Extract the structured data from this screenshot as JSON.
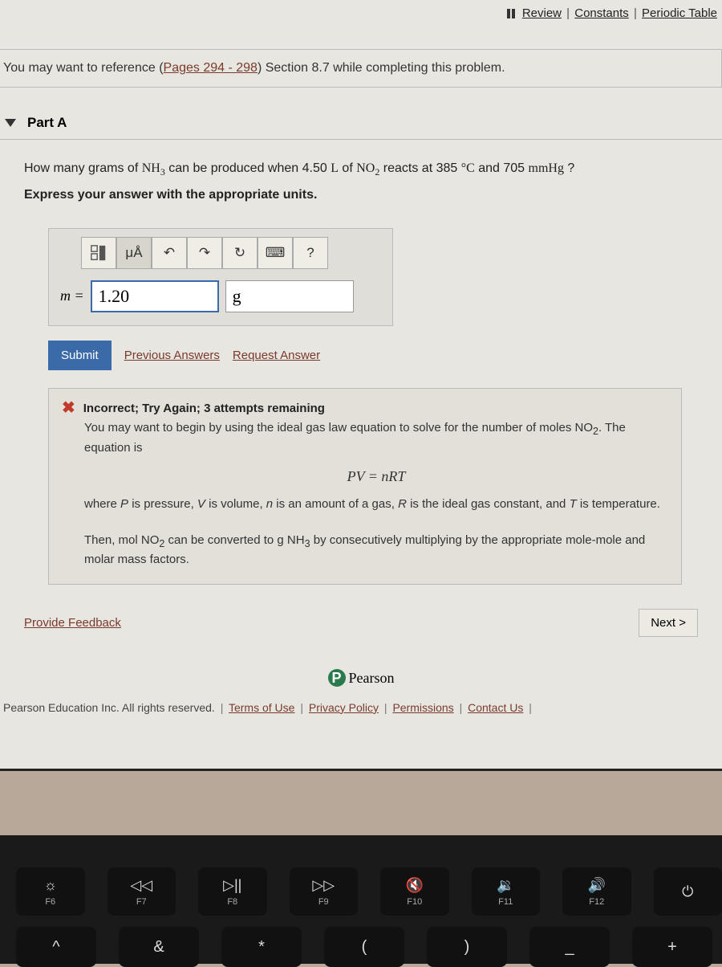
{
  "top_links": {
    "review": "Review",
    "constants": "Constants",
    "periodic": "Periodic Table"
  },
  "reference": {
    "prefix": "You may want to reference (",
    "pages": "Pages 294 - 298",
    "suffix": ") Section 8.7 while completing this problem."
  },
  "part": {
    "label": "Part A"
  },
  "question": {
    "pre": "How many grams of ",
    "chem1a": "NH",
    "chem1b": "3",
    "mid1": " can be produced when 4.50 ",
    "L": "L",
    "mid2": " of ",
    "chem2a": "NO",
    "chem2b": "2",
    "mid3": " reacts at 385 ",
    "deg": "°C",
    "mid4": " and 705 ",
    "mmhg": "mmHg",
    "qmark": " ?",
    "instruction": "Express your answer with the appropriate units."
  },
  "toolbar": {
    "templates": "templates",
    "units_label": "μÅ",
    "undo": "↶",
    "redo": "↷",
    "reset": "↻",
    "keyboard": "⌨",
    "help": "?"
  },
  "answer": {
    "var": "m =",
    "value": "1.20",
    "unit": "g"
  },
  "actions": {
    "submit": "Submit",
    "previous": "Previous Answers",
    "request": "Request Answer"
  },
  "feedback": {
    "title": "Incorrect; Try Again; 3 attempts remaining",
    "line1a": "You may want to begin by using the ideal gas law equation to solve for the number of moles ",
    "line1chem_a": "NO",
    "line1chem_b": "2",
    "line1b": ". The equation is",
    "equation": "PV = nRT",
    "line2a": "where ",
    "P": "P",
    "line2b": " is pressure, ",
    "V": "V",
    "line2c": " is volume, ",
    "n": "n",
    "line2d": " is an amount of a gas, ",
    "R": "R",
    "line2e": " is the ideal gas constant, and ",
    "T": "T",
    "line2f": " is temperature.",
    "line3a": "Then, ",
    "mol": "mol NO",
    "molsub": "2",
    "line3b": " can be converted to ",
    "g": "g NH",
    "gsub": "3",
    "line3c": " by consecutively multiplying by the appropriate mole-mole and molar mass factors."
  },
  "bottom": {
    "provide": "Provide Feedback",
    "next": "Next >"
  },
  "brand": {
    "name": "Pearson"
  },
  "footer": {
    "copyright": "Pearson Education Inc. All rights reserved.",
    "terms": "Terms of Use",
    "privacy": "Privacy Policy",
    "permissions": "Permissions",
    "contact": "Contact Us"
  },
  "keyboard": {
    "row1": [
      {
        "glyph": "☼",
        "label": "F6"
      },
      {
        "glyph": "◁◁",
        "label": "F7"
      },
      {
        "glyph": "▷||",
        "label": "F8"
      },
      {
        "glyph": "▷▷",
        "label": "F9"
      },
      {
        "glyph": "🔇",
        "label": "F10"
      },
      {
        "glyph": "🔉",
        "label": "F11"
      },
      {
        "glyph": "🔊",
        "label": "F12"
      },
      {
        "glyph": "⏻",
        "label": ""
      }
    ],
    "row2": [
      "^",
      "&",
      "*",
      "(",
      ")",
      "_",
      "+"
    ]
  }
}
